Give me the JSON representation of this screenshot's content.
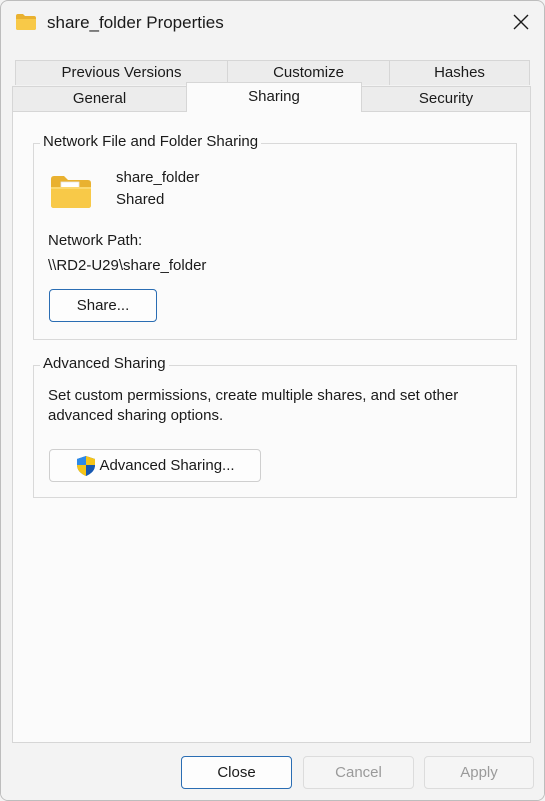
{
  "window": {
    "title": "share_folder Properties"
  },
  "tabs": {
    "row_top": [
      "Previous Versions",
      "Customize",
      "Hashes"
    ],
    "row_bottom": [
      "General",
      "Sharing",
      "Security"
    ],
    "active": "Sharing"
  },
  "network_sharing": {
    "group_title": "Network File and Folder Sharing",
    "folder_name": "share_folder",
    "status": "Shared",
    "path_label": "Network Path:",
    "path_value": "\\\\RD2-U29\\share_folder",
    "share_button": "Share..."
  },
  "advanced_sharing": {
    "group_title": "Advanced Sharing",
    "description_line1": "Set custom permissions, create multiple shares, and set other",
    "description_line2": "advanced sharing options.",
    "button": "Advanced Sharing..."
  },
  "footer": {
    "close": "Close",
    "cancel": "Cancel",
    "apply": "Apply"
  },
  "icons": {
    "title": "folder-icon",
    "close": "close-icon",
    "folder": "shared-folder-icon",
    "shield": "uac-shield-icon"
  },
  "colors": {
    "folder_yellow": "#f8c948",
    "accent_border": "#2a6db3"
  }
}
